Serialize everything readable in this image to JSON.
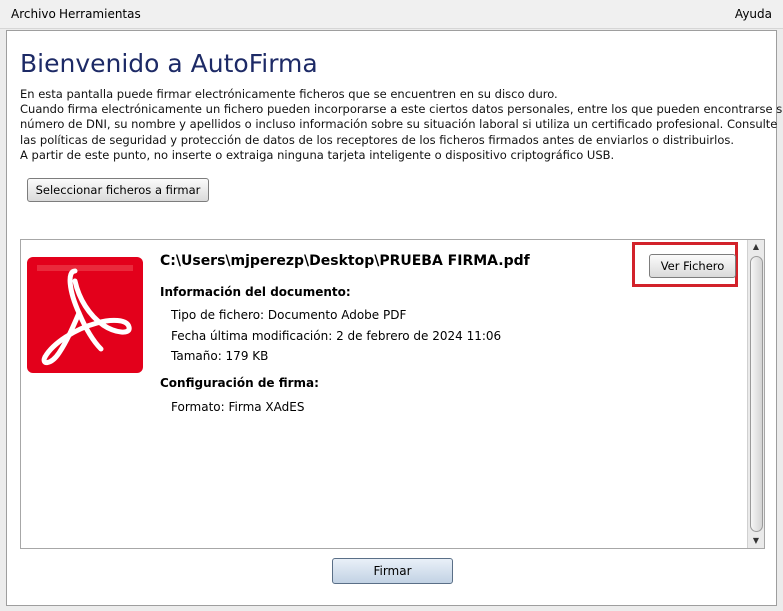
{
  "menubar": {
    "archivo": "Archivo",
    "herramientas": "Herramientas",
    "ayuda": "Ayuda"
  },
  "main": {
    "title": "Bienvenido a AutoFirma",
    "intro_lines": [
      "En esta pantalla puede firmar electrónicamente ficheros que se encuentren en su disco duro.",
      "Cuando firma electrónicamente un fichero pueden incorporarse a este ciertos datos personales, entre los que pueden encontrarse su",
      "número de DNI, su nombre y apellidos o incluso información sobre su situación laboral si utiliza un certificado profesional. Consulte",
      "las políticas de seguridad y protección de datos de los receptores de los ficheros firmados antes de enviarlos o distribuirlos.",
      "A partir de este punto, no inserte o extraiga ninguna tarjeta inteligente o dispositivo criptográfico USB."
    ],
    "select_button": "Seleccionar ficheros a firmar",
    "sign_button": "Firmar"
  },
  "file": {
    "path": "C:\\Users\\mjperezp\\Desktop\\PRUEBA FIRMA.pdf",
    "view_button": "Ver Fichero",
    "doc_info_heading": "Información del documento:",
    "type": "Tipo de fichero: Documento Adobe PDF",
    "modified": "Fecha última modificación: 2 de febrero de 2024 11:06",
    "size": "Tamaño: 179 KB",
    "sign_config_heading": "Configuración de firma:",
    "format": "Formato: Firma XAdES"
  },
  "colors": {
    "title": "#1d2a66",
    "pdf_icon_red": "#e3001b",
    "highlight_border": "#d2222a"
  },
  "icons": {
    "file_icon": "adobe-pdf-icon"
  }
}
